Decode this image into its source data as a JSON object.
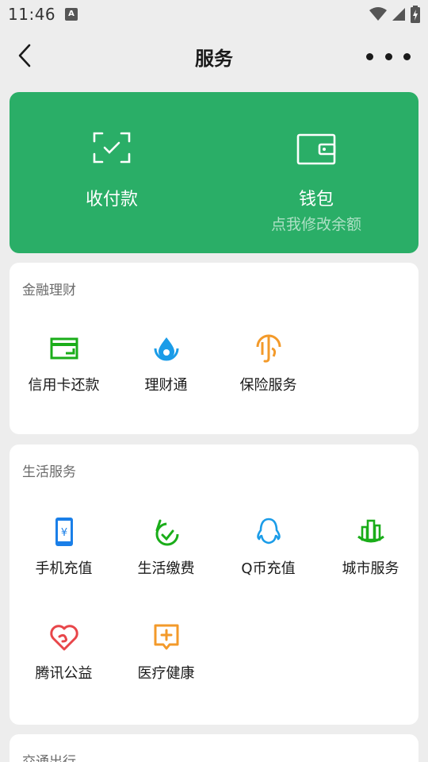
{
  "status": {
    "time": "11:46",
    "notif_icon": "a-notification-icon",
    "wifi_icon": "wifi-icon",
    "signal_icon": "signal-icon",
    "battery_icon": "battery-charging-icon"
  },
  "nav": {
    "title": "服务",
    "back_icon": "back-chevron-icon",
    "more_icon": "more-dots-icon"
  },
  "wallet_card": {
    "bg": "#2aae67",
    "pay": {
      "label": "收付款",
      "icon": "scan-check-icon"
    },
    "wallet": {
      "label": "钱包",
      "sub": "点我修改余额",
      "icon": "wallet-icon"
    }
  },
  "finance": {
    "title": "金融理财",
    "items": [
      {
        "label": "信用卡还款",
        "icon": "credit-card-icon",
        "color": "#1aad19"
      },
      {
        "label": "理财通",
        "icon": "wealth-drop-icon",
        "color": "#1a9ce8"
      },
      {
        "label": "保险服务",
        "icon": "insurance-umbrella-icon",
        "color": "#f39a2a"
      }
    ]
  },
  "life": {
    "title": "生活服务",
    "items": [
      {
        "label": "手机充值",
        "icon": "phone-recharge-icon",
        "color": "#1a7fe8"
      },
      {
        "label": "生活缴费",
        "icon": "bill-pay-icon",
        "color": "#1aad19"
      },
      {
        "label": "Q币充值",
        "icon": "qq-penguin-icon",
        "color": "#1a9ce8"
      },
      {
        "label": "城市服务",
        "icon": "city-service-icon",
        "color": "#1aad19"
      },
      {
        "label": "腾讯公益",
        "icon": "charity-heart-icon",
        "color": "#e8464a"
      },
      {
        "label": "医疗健康",
        "icon": "medical-cross-icon",
        "color": "#f39a2a"
      }
    ]
  },
  "transport": {
    "title": "交通出行"
  }
}
